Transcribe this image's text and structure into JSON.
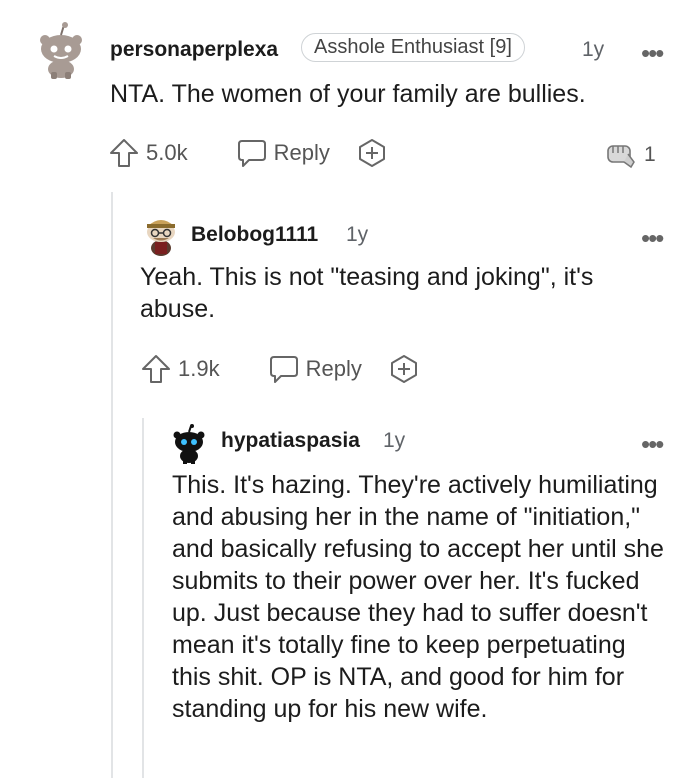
{
  "comments": [
    {
      "username": "personaperplexa",
      "flair": "Asshole Enthusiast [9]",
      "time": "1y",
      "body": "NTA. The women of your family are bullies.",
      "upvotes": "5.0k",
      "reply_label": "Reply",
      "award_count": "1"
    },
    {
      "username": "Belobog1111",
      "time": "1y",
      "body": "Yeah. This is not \"teasing and joking\", it's abuse.",
      "upvotes": "1.9k",
      "reply_label": "Reply"
    },
    {
      "username": "hypatiaspasia",
      "time": "1y",
      "body": "This. It's hazing. They're actively humiliating and abusing her in the name of \"initiation,\" and basically refusing to accept her until she submits to their power over her. It's fucked up. Just because they had to suffer doesn't mean it's totally fine to keep perpetuating this shit. OP is NTA, and good for him for standing up for his new wife."
    }
  ],
  "icons": {
    "more": "more-options-icon",
    "upvote": "upvote-arrow-icon",
    "reply": "reply-bubble-icon",
    "award": "award-plus-icon",
    "achievement": "fist-award-icon"
  }
}
